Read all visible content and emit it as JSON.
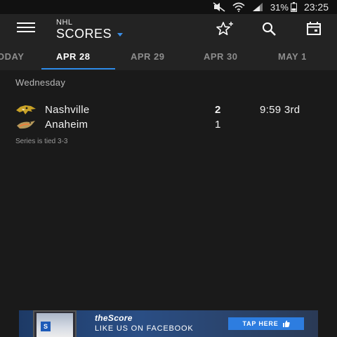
{
  "status_bar": {
    "battery": "31%",
    "time": "23:25"
  },
  "header": {
    "league": "NHL",
    "title": "SCORES",
    "menu_icon": "hamburger-menu-icon",
    "favorites_icon": "star-add-icon",
    "search_icon": "search-icon",
    "calendar_icon": "calendar-icon"
  },
  "date_tabs": [
    {
      "label": "ODAY",
      "active": false
    },
    {
      "label": "APR 28",
      "active": true
    },
    {
      "label": "APR 29",
      "active": false
    },
    {
      "label": "APR 30",
      "active": false
    },
    {
      "label": "MAY 1",
      "active": false
    }
  ],
  "day": "Wednesday",
  "game": {
    "home": {
      "name": "Nashville",
      "score": "2",
      "logo": "predators-logo"
    },
    "away": {
      "name": "Anaheim",
      "score": "1",
      "logo": "ducks-logo"
    },
    "status": "9:59 3rd",
    "series": "Series is tied 3-3"
  },
  "ad": {
    "brand": "theScore",
    "text": "LIKE US ON FACEBOOK",
    "cta": "TAP HERE",
    "phone_badge": "S"
  },
  "colors": {
    "accent": "#2d8ae8",
    "background": "#1a1a1a",
    "toolbar": "#232323"
  }
}
